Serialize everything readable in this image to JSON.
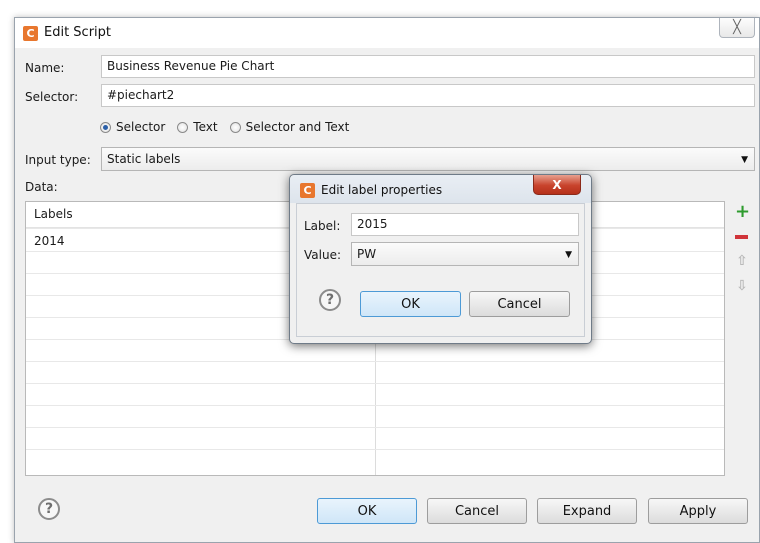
{
  "window": {
    "title": "Edit Script",
    "app_icon_letter": "C",
    "close_glyph": "╳"
  },
  "form": {
    "name_label": "Name:",
    "name_value": "Business Revenue Pie Chart",
    "selector_label": "Selector:",
    "selector_value": "#piechart2",
    "radio_options": [
      {
        "label": "Selector",
        "selected": true
      },
      {
        "label": "Text",
        "selected": false
      },
      {
        "label": "Selector and Text",
        "selected": false
      }
    ],
    "input_type_label": "Input type:",
    "input_type_value": "Static labels",
    "data_label": "Data:"
  },
  "table": {
    "columns": [
      "Labels",
      ""
    ],
    "rows": [
      [
        "2014",
        ""
      ]
    ]
  },
  "side_icons": [
    "add-icon",
    "remove-icon",
    "move-up-icon",
    "move-down-icon"
  ],
  "buttons": {
    "help": "?",
    "ok": "OK",
    "cancel": "Cancel",
    "expand": "Expand",
    "apply": "Apply"
  },
  "dialog": {
    "title": "Edit label properties",
    "app_icon_letter": "C",
    "close_glyph": "X",
    "label_label": "Label:",
    "label_value": "2015",
    "value_label": "Value:",
    "value_value": "PW",
    "help": "?",
    "ok": "OK",
    "cancel": "Cancel"
  },
  "colors": {
    "accent": "#e8772e",
    "default_button_border": "#4d9ad6",
    "close_red": "#c8432c"
  }
}
